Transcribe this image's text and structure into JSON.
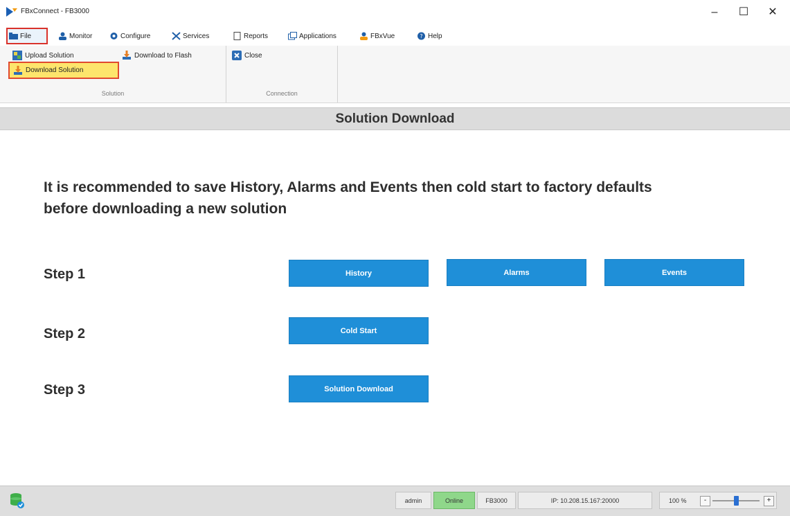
{
  "window": {
    "title": "FBxConnect - FB3000",
    "minimize": "–",
    "maximize": "☐",
    "close": "✕"
  },
  "menu": {
    "tabs": [
      {
        "label": "File",
        "icon": "folder-icon"
      },
      {
        "label": "Monitor",
        "icon": "monitor-user-icon"
      },
      {
        "label": "Configure",
        "icon": "gear-icon"
      },
      {
        "label": "Services",
        "icon": "tools-icon"
      },
      {
        "label": "Reports",
        "icon": "report-icon"
      },
      {
        "label": "Applications",
        "icon": "applications-icon"
      },
      {
        "label": "FBxVue",
        "icon": "fbxvue-icon"
      },
      {
        "label": "Help",
        "icon": "help-icon"
      }
    ]
  },
  "ribbon": {
    "solution": {
      "group_label": "Solution",
      "upload_solution": "Upload Solution",
      "download_solution": "Download Solution",
      "download_to_flash": "Download to Flash"
    },
    "connection": {
      "group_label": "Connection",
      "close": "Close"
    }
  },
  "page": {
    "heading": "Solution Download",
    "recommendation": "It is recommended to save History, Alarms and Events then cold start to factory defaults before downloading a new solution",
    "step1_label": "Step 1",
    "step2_label": "Step 2",
    "step3_label": "Step 3",
    "history_button": "History",
    "alarms_button": "Alarms",
    "events_button": "Events",
    "cold_start_button": "Cold Start",
    "solution_download_button": "Solution Download"
  },
  "status": {
    "user": "admin",
    "connection": "Online",
    "device": "FB3000",
    "ip": "IP: 10.208.15.167:20000",
    "zoom": "100 %",
    "zoom_minus": "-",
    "zoom_plus": "+",
    "zoom_level": 0.5
  },
  "colors": {
    "accent_button": "#1f8fd8",
    "highlight": "#fde56c",
    "highlight_border": "#e0492f",
    "online": "#8fd78a"
  }
}
